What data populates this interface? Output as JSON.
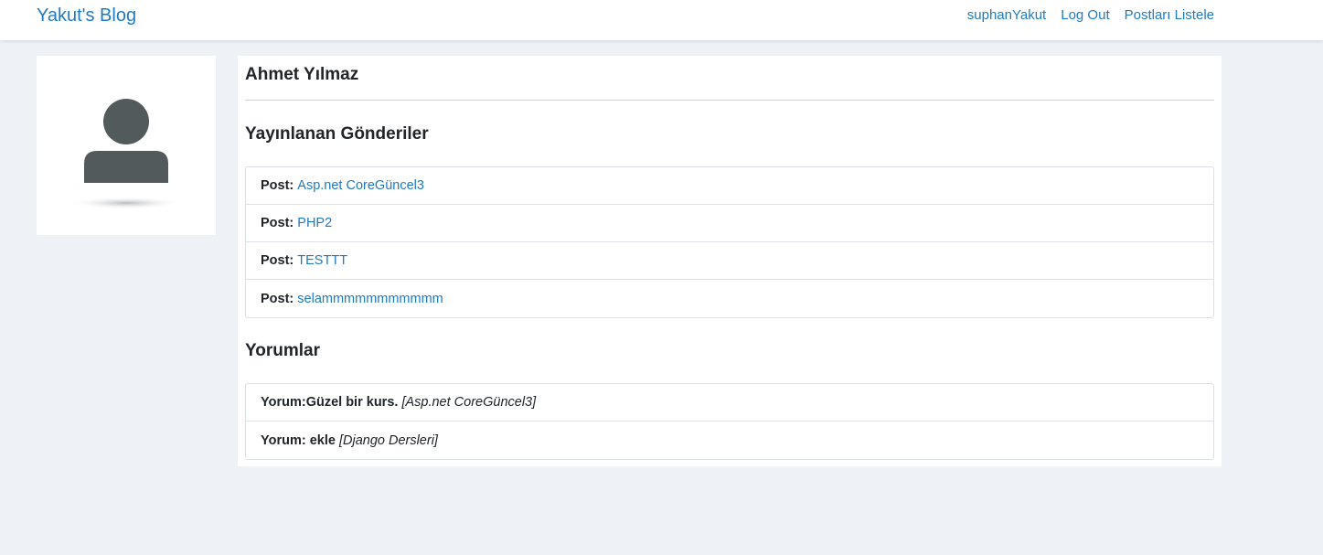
{
  "navbar": {
    "brand": "Yakut's Blog",
    "links": [
      {
        "label": "suphanYakut"
      },
      {
        "label": "Log Out"
      },
      {
        "label": "Postları Listele"
      }
    ]
  },
  "profile": {
    "name": "Ahmet Yılmaz",
    "avatar_icon": "user-placeholder-icon"
  },
  "posts_section": {
    "title": "Yayınlanan Gönderiler",
    "label": "Post:",
    "items": [
      {
        "title": "Asp.net CoreGüncel3"
      },
      {
        "title": "PHP2"
      },
      {
        "title": "TESTTT"
      },
      {
        "title": "selammmmmmmmmmm"
      }
    ]
  },
  "comments_section": {
    "title": "Yorumlar",
    "items": [
      {
        "label": "Yorum:",
        "text": "Güzel bir kurs.",
        "post": "[Asp.net CoreGüncel3]"
      },
      {
        "label": "Yorum:",
        "text": " ekle",
        "post": "[Django Dersleri]"
      }
    ]
  },
  "colors": {
    "link": "#1f7bc1",
    "background": "#eef1f6",
    "card": "#ffffff"
  }
}
